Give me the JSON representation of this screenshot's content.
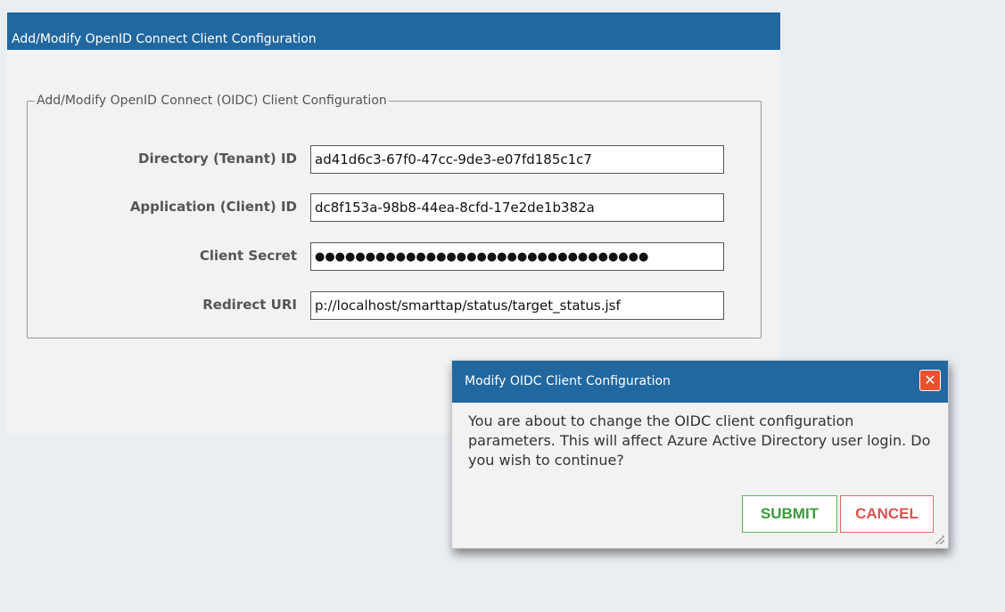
{
  "panel": {
    "title": "Add/Modify OpenID Connect Client Configuration",
    "fieldset_legend": "Add/Modify OpenID Connect (OIDC) Client Configuration",
    "fields": [
      {
        "label": "Directory (Tenant) ID",
        "value": "ad41d6c3-67f0-47cc-9de3-e07fd185c1c7"
      },
      {
        "label": "Application (Client) ID",
        "value": "dc8f153a-98b8-44ea-8cfd-17e2de1b382a"
      },
      {
        "label": "Client Secret",
        "value": "●●●●●●●●●●●●●●●●●●●●●●●●●●●●●●●●●"
      },
      {
        "label": "Redirect URI",
        "value": "p://localhost/smarttap/status/target_status.jsf"
      }
    ]
  },
  "dialog": {
    "title": "Modify OIDC Client Configuration",
    "close_icon": "✕",
    "message": "You are about to change the OIDC client configuration parameters. This will affect Azure Active Directory user login. Do you wish to continue?",
    "submit_label": "SUBMIT",
    "cancel_label": "CANCEL"
  }
}
